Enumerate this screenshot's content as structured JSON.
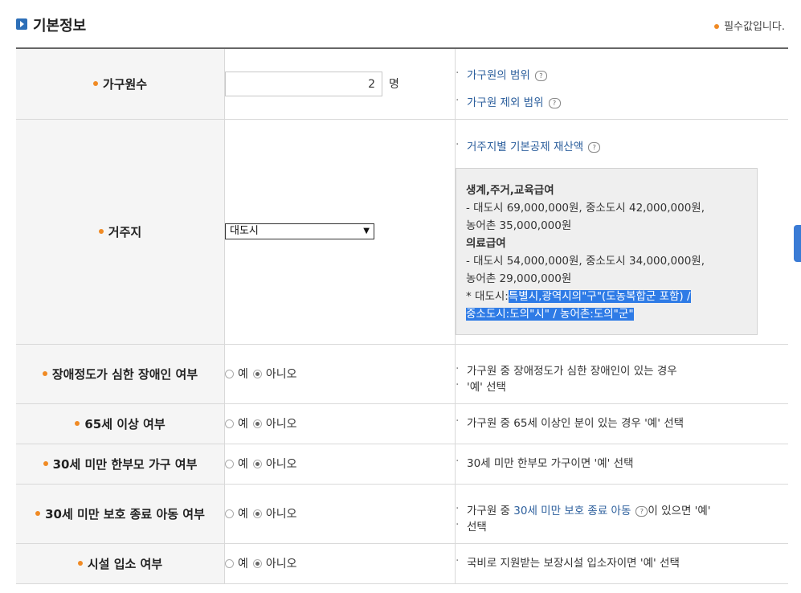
{
  "header": {
    "title": "기본정보",
    "required_note": "필수값입니다."
  },
  "household": {
    "label": "가구원수",
    "value": "2",
    "unit": "명",
    "help": [
      "가구원의 범위",
      "가구원 제외 범위"
    ]
  },
  "residence": {
    "label": "거주지",
    "selected": "대도시",
    "help_link": "거주지별 기본공제 재산액",
    "box": {
      "line1": "생계,주거,교육급여",
      "line2": "- 대도시 69,000,000원, 중소도시 42,000,000원,",
      "line3": "농어촌 35,000,000원",
      "line4": "의료급여",
      "line5": "- 대도시 54,000,000원, 중소도시 34,000,000원,",
      "line6": "농어촌 29,000,000원",
      "note_prefix": "* 대도시:",
      "note_sel1": "특별시,광역시의\"구\"(도농복합군 포함) /",
      "note_sel2": "중소도시:도의\"시\" / 농어촌:도의\"군\""
    }
  },
  "radio_labels": {
    "yes": "예",
    "no": "아니오"
  },
  "rows": [
    {
      "label": "장애정도가 심한 장애인 여부",
      "help1": "가구원 중 장애정도가 심한 장애인이 있는 경우",
      "help2": "'예' 선택"
    },
    {
      "label": "65세 이상 여부",
      "help1": "가구원 중 65세 이상인 분이 있는 경우 '예' 선택"
    },
    {
      "label": "30세 미만 한부모 가구 여부",
      "help1": "30세 미만 한부모 가구이면 '예' 선택"
    },
    {
      "label": "30세 미만 보호 종료 아동 여부",
      "help_pre": "가구원 중 ",
      "help_link": "30세 미만 보호 종료 아동",
      "help_post": "이 있으면 '예'",
      "help2": "선택"
    },
    {
      "label": "시설 입소 여부",
      "help1": "국비로 지원받는 보장시설 입소자이면 '예' 선택"
    }
  ]
}
